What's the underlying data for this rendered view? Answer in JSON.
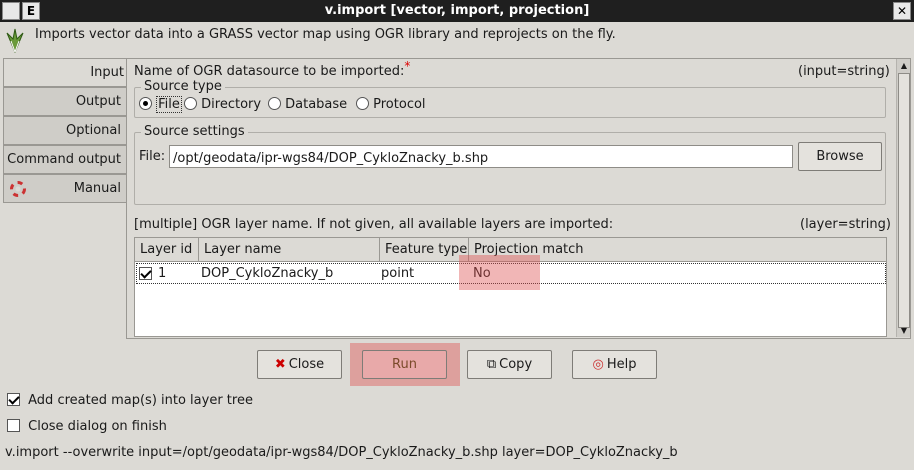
{
  "window": {
    "title": "v.import [vector, import, projection]",
    "menu_button": "E",
    "description": "Imports vector data into a GRASS vector map using OGR library and reprojects on the fly."
  },
  "tabs": [
    {
      "label": "Input"
    },
    {
      "label": "Output"
    },
    {
      "label": "Optional"
    },
    {
      "label": "Command output"
    },
    {
      "label": "Manual"
    }
  ],
  "input": {
    "datasource_label": "Name of OGR datasource to be imported:",
    "required_mark": "*",
    "datasource_param": "(input=string)",
    "source_type": {
      "title": "Source type",
      "options": [
        {
          "label": "File",
          "selected": true
        },
        {
          "label": "Directory",
          "selected": false
        },
        {
          "label": "Database",
          "selected": false
        },
        {
          "label": "Protocol",
          "selected": false
        }
      ]
    },
    "source_settings": {
      "title": "Source settings",
      "file_label": "File:",
      "file_value": "/opt/geodata/ipr-wgs84/DOP_CykloZnacky_b.shp",
      "browse_label": "Browse"
    },
    "layer_label": "[multiple] OGR layer name. If not given, all available layers are imported:",
    "layer_param": "(layer=string)",
    "table": {
      "columns": [
        "Layer id",
        "Layer name",
        "Feature type",
        "Projection match"
      ],
      "rows": [
        {
          "checked": true,
          "layer_id": "1",
          "layer_name": "DOP_CykloZnacky_b",
          "feature_type": "point",
          "projection_match": "No"
        }
      ]
    }
  },
  "buttons": {
    "close": "Close",
    "run": "Run",
    "copy": "Copy",
    "help": "Help"
  },
  "options": {
    "add_to_tree": {
      "label": "Add created map(s) into layer tree",
      "checked": true
    },
    "close_on_finish": {
      "label": "Close dialog on finish",
      "checked": false
    }
  },
  "status": {
    "command": "v.import --overwrite input=/opt/geodata/ipr-wgs84/DOP_CykloZnacky_b.shp layer=DOP_CykloZnacky_b"
  },
  "colors": {
    "background": "#dcdad5",
    "titlebar": "#1f1f1f",
    "highlight": "#de5050",
    "required": "#dd0000"
  }
}
